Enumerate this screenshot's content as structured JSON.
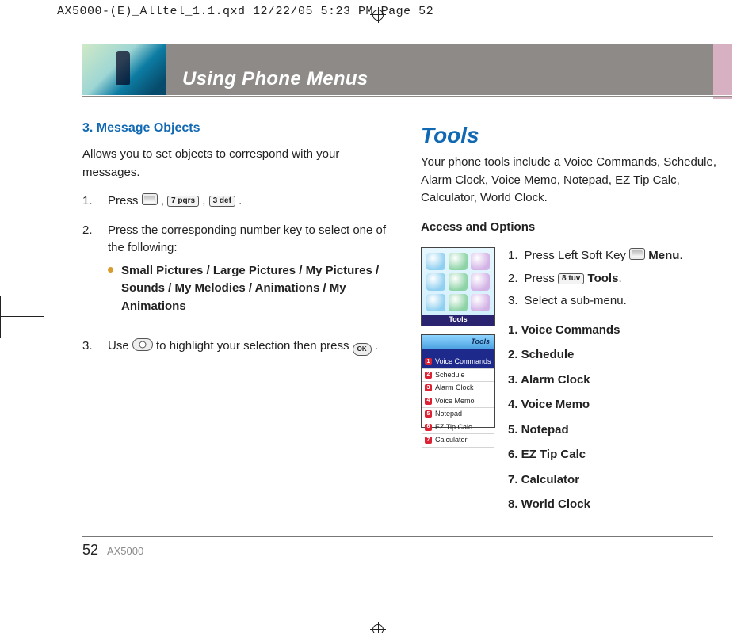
{
  "runhead": "AX5000-(E)_Alltel_1.1.qxd  12/22/05  5:23 PM  Page 52",
  "banner_title": "Using Phone Menus",
  "left": {
    "heading": "3. Message Objects",
    "intro": "Allows you to set objects to correspond with your messages.",
    "s1_n": "1.",
    "s1_a": "Press ",
    "s1_b": " , ",
    "s1_key7": "7 pqrs",
    "s1_c": " , ",
    "s1_key3": "3 def",
    "s1_d": " .",
    "s2_n": "2.",
    "s2": "Press the corresponding number key to select one of the following:",
    "bullet": "Small Pictures / Large Pictures / My Pictures / Sounds / My Melodies / Animations / My Animations",
    "s3_n": "3.",
    "s3_a": "Use ",
    "s3_b": " to highlight your selection then press ",
    "ok": "OK",
    "s3_c": " ."
  },
  "right": {
    "heading": "Tools",
    "intro": "Your phone tools include a Voice Commands, Schedule, Alarm Clock, Voice Memo, Notepad, EZ Tip Calc, Calculator, World Clock.",
    "sub": "Access and Options",
    "s1_n": "1.",
    "s1_a": "Press Left Soft Key ",
    "s1_b": " ",
    "s1_menu": "Menu",
    "s1_c": ".",
    "s2_n": "2.",
    "s2_a": "Press ",
    "s2_key8": "8 tuv",
    "s2_b": " ",
    "s2_tools": "Tools",
    "s2_c": ".",
    "s3_n": "3.",
    "s3": "Select a sub-menu.",
    "menu": {
      "i1": "1. Voice Commands",
      "i2": "2. Schedule",
      "i3": "3. Alarm Clock",
      "i4": "4. Voice Memo",
      "i5": "5. Notepad",
      "i6": "6. EZ Tip Calc",
      "i7": "7. Calculator",
      "i8": "8. World Clock"
    },
    "shot1_caption": "Tools",
    "shot2_title": "Tools",
    "shot2": {
      "m1": "Voice Commands",
      "m2": "Schedule",
      "m3": "Alarm Clock",
      "m4": "Voice Memo",
      "m5": "Notepad",
      "m6": "EZ Tip Calc",
      "m7": "Calculator"
    }
  },
  "footer": {
    "page": "52",
    "model": "AX5000"
  }
}
